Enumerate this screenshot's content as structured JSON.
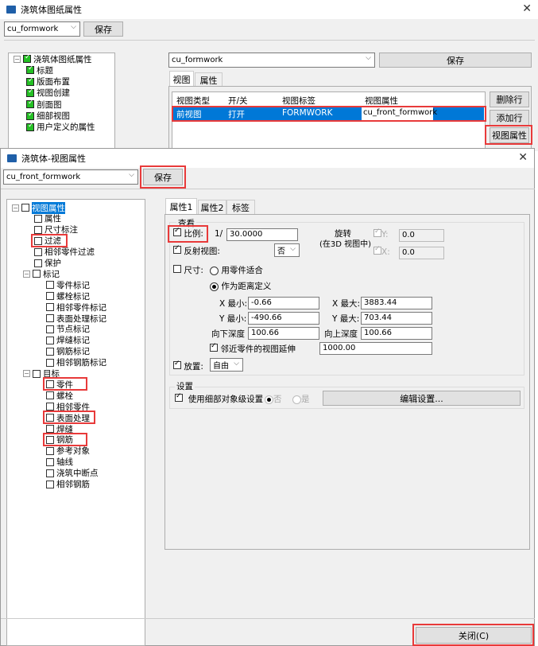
{
  "drawing_dialog": {
    "title": "浇筑体图纸属性",
    "preset": "cu_formwork",
    "save": "保存",
    "tree": [
      {
        "label": "浇筑体图纸属性"
      },
      {
        "label": "标题"
      },
      {
        "label": "版面布置"
      },
      {
        "label": "视图创建"
      },
      {
        "label": "剖面图"
      },
      {
        "label": "细部视图"
      },
      {
        "label": "用户定义的属性"
      }
    ],
    "right_preset": "cu_formwork",
    "right_save": "保存",
    "tabs": [
      "视图",
      "属性"
    ],
    "table": {
      "headers": [
        "视图类型",
        "开/关",
        "视图标签",
        "视图属性"
      ],
      "rows": [
        [
          "前视图",
          "打开",
          "FORMWORK",
          "cu_front_formwork"
        ]
      ]
    },
    "buttons": {
      "delete_row": "删除行",
      "add_row": "添加行",
      "view_props": "视图属性"
    }
  },
  "view_dialog": {
    "title": "浇筑体-视图属性",
    "preset": "cu_front_formwork",
    "save": "保存",
    "tree": [
      "视图属性",
      "属性",
      "尺寸标注",
      "过滤",
      "相邻零件过滤",
      "保护",
      "标记",
      "零件标记",
      "螺栓标记",
      "相邻零件标记",
      "表面处理标记",
      "节点标记",
      "焊缝标记",
      "钢筋标记",
      "相邻钢筋标记",
      "目标",
      "零件",
      "螺栓",
      "相邻零件",
      "表面处理",
      "焊缝",
      "钢筋",
      "参考对象",
      "轴线",
      "浇筑中断点",
      "相邻钢筋"
    ],
    "tabs": [
      "属性1",
      "属性2",
      "标签"
    ],
    "view_group": "查看",
    "scale_label": "比例:",
    "scale_prefix": "1/",
    "scale_value": "30.0000",
    "mirror_label": "反射视图:",
    "mirror_value": "否",
    "rotate_label": "旋转",
    "rotate_sub": "(在3D 视图中)",
    "rot_y_label": "Y:",
    "rot_y": "0.0",
    "rot_x_label": "X:",
    "rot_x": "0.0",
    "size_label": "尺寸:",
    "fit_parts": "用零件适合",
    "by_distance": "作为距离定义",
    "xmin_label": "X 最小:",
    "xmin": "-0.66",
    "xmax_label": "X 最大:",
    "xmax": "3883.44",
    "ymin_label": "Y 最小:",
    "ymin": "-490.66",
    "ymax_label": "Y 最大:",
    "ymax": "703.44",
    "depth_down_label": "向下深度",
    "depth_down": "100.66",
    "depth_up_label": "向上深度",
    "depth_up": "100.66",
    "extension_label": "邻近零件的视图延伸",
    "extension": "1000.00",
    "placement_label": "放置:",
    "placement_value": "自由",
    "settings_group": "设置",
    "use_detail": "使用细部对象级设置",
    "no": "否",
    "yes": "是",
    "edit_settings": "编辑设置...",
    "close": "关闭(C)"
  }
}
